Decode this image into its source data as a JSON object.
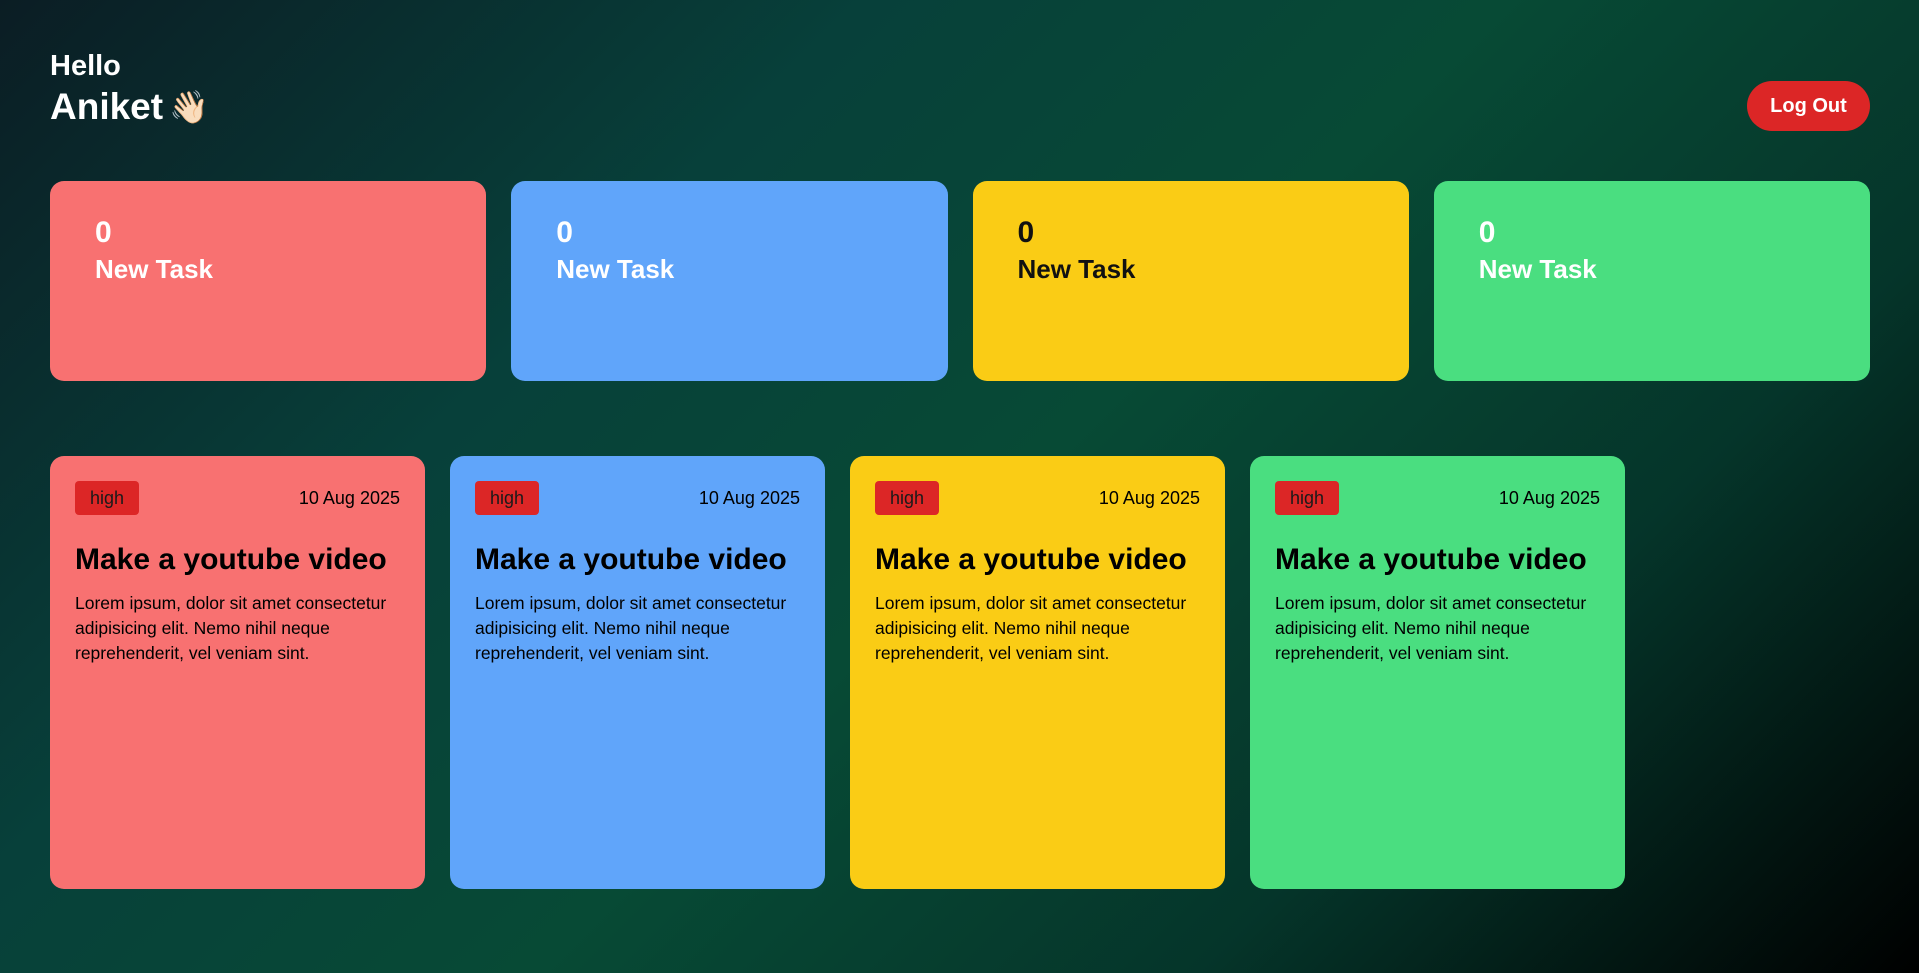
{
  "header": {
    "greeting": "Hello",
    "name": "Aniket",
    "wave_emoji": "👋🏻"
  },
  "logout_label": "Log Out",
  "stats": [
    {
      "count": "0",
      "label": "New Task",
      "color": "#f87171",
      "text_color": "#ffffff"
    },
    {
      "count": "0",
      "label": "New Task",
      "color": "#60a5fa",
      "text_color": "#ffffff"
    },
    {
      "count": "0",
      "label": "New Task",
      "color": "#facc15",
      "text_color": "#111111"
    },
    {
      "count": "0",
      "label": "New Task",
      "color": "#4ade80",
      "text_color": "#ffffff"
    }
  ],
  "tasks": [
    {
      "priority": "high",
      "date": "10 Aug 2025",
      "title": "Make a youtube video",
      "description": "Lorem ipsum, dolor sit amet consectetur adipisicing elit. Nemo nihil neque reprehenderit, vel veniam sint.",
      "color": "#f87171"
    },
    {
      "priority": "high",
      "date": "10 Aug 2025",
      "title": "Make a youtube video",
      "description": "Lorem ipsum, dolor sit amet consectetur adipisicing elit. Nemo nihil neque reprehenderit, vel veniam sint.",
      "color": "#60a5fa"
    },
    {
      "priority": "high",
      "date": "10 Aug 2025",
      "title": "Make a youtube video",
      "description": "Lorem ipsum, dolor sit amet consectetur adipisicing elit. Nemo nihil neque reprehenderit, vel veniam sint.",
      "color": "#facc15"
    },
    {
      "priority": "high",
      "date": "10 Aug 2025",
      "title": "Make a youtube video",
      "description": "Lorem ipsum, dolor sit amet consectetur adipisicing elit. Nemo nihil neque reprehenderit, vel veniam sint.",
      "color": "#4ade80"
    }
  ],
  "colors": {
    "priority_badge": "#dc2626",
    "logout_button": "#dc2626"
  }
}
